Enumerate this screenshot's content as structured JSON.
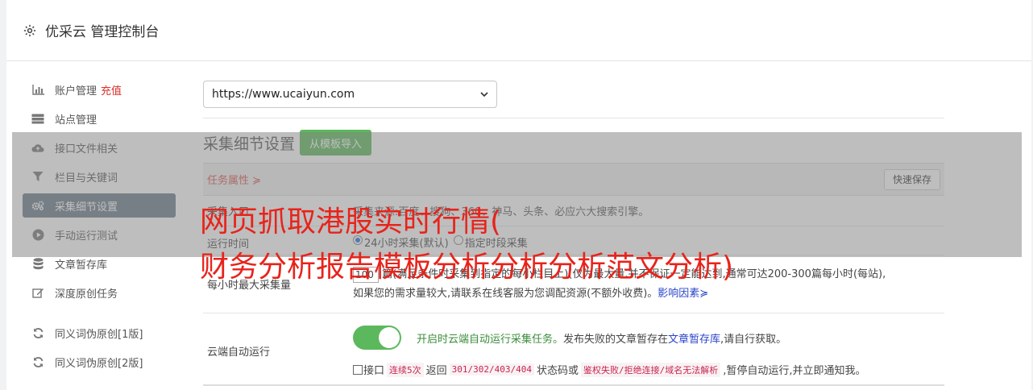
{
  "header": {
    "title": "优采云 管理控制台"
  },
  "sidebar": {
    "items": [
      {
        "label": "账户管理",
        "extra": "充值",
        "icon": "bar-chart-icon"
      },
      {
        "label": "站点管理",
        "icon": "server-icon"
      },
      {
        "label": "接口文件相关",
        "icon": "cloud-upload-icon"
      },
      {
        "label": "栏目与关键词",
        "icon": "filter-icon"
      },
      {
        "label": "采集细节设置",
        "icon": "gears-icon"
      },
      {
        "label": "手动运行测试",
        "icon": "play-circle-icon"
      },
      {
        "label": "文章暂存库",
        "icon": "database-icon"
      },
      {
        "label": "深度原创任务",
        "icon": "edit-icon"
      },
      {
        "label": "同义词伪原创[1版]",
        "icon": "refresh-icon"
      },
      {
        "label": "同义词伪原创[2版]",
        "icon": "refresh-icon"
      }
    ]
  },
  "main": {
    "site_select": "https://www.ucaiyun.com",
    "section_title": "采集细节设置",
    "import_button": "从模板导入",
    "task_props": "任务属性",
    "quick_save": "快速保存",
    "row1": {
      "label": "采集入口",
      "value": "采集来源:百度、搜狗、360、神马、头条、必应六大搜索引擎。"
    },
    "row2": {
      "label": "运行时间",
      "opt1": "24小时采集(默认)",
      "opt2": "指定时段采集"
    },
    "row3": {
      "label": "每小时最大采集量",
      "amount": "100",
      "line1": "篇(满足条件时采集到指定的每小栏目上)(仅为最大量,并不保证一定能达到,通常可达200-300篇每小时(每站),",
      "line2": "如果您的需求量较大,请联系在线客服为您调配资源(不额外收费)。",
      "link": "影响因素"
    },
    "row4": {
      "label": "云端自动运行",
      "toggle_on_text": "开启时云端自动运行采集任务。",
      "desc_a": "发布失败的文章暂存在",
      "desc_link": "文章暂存库",
      "desc_b": ",请自行获取。",
      "cb_a": "接口",
      "code1": "连续5次",
      "cb_b": "返回",
      "code2": "301/302/403/404",
      "cb_c": "状态码或",
      "code3": "鉴权失败/拒绝连接/域名无法解析",
      "cb_d": ",暂停自动运行,并立即通知我。"
    }
  },
  "watermark": {
    "line1": "网页抓取港股实时行情(",
    "line2": "财务分析报告模板分析分析分析范文分析)"
  }
}
